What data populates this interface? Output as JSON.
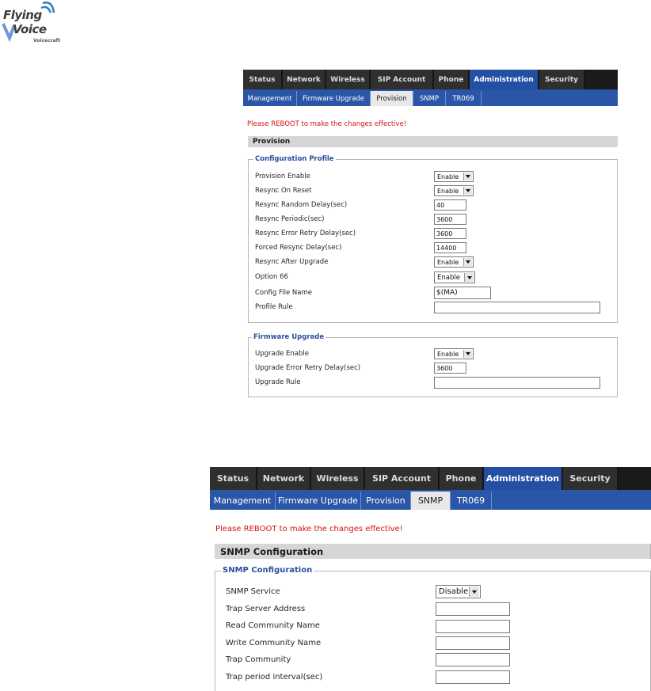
{
  "logo": {
    "line1": "Flying",
    "line2": "Voice",
    "line3": "Voicecraft"
  },
  "panel1": {
    "main_tabs": [
      {
        "label": "Status",
        "active": false
      },
      {
        "label": "Network",
        "active": false
      },
      {
        "label": "Wireless",
        "active": false
      },
      {
        "label": "SIP Account",
        "active": false
      },
      {
        "label": "Phone",
        "active": false
      },
      {
        "label": "Administration",
        "active": true
      },
      {
        "label": "Security",
        "active": false
      }
    ],
    "sub_tabs": [
      {
        "label": "Management",
        "active": false
      },
      {
        "label": "Firmware Upgrade",
        "active": false
      },
      {
        "label": "Provision",
        "active": true
      },
      {
        "label": "SNMP",
        "active": false
      },
      {
        "label": "TR069",
        "active": false
      }
    ],
    "warning": "Please REBOOT to make the changes effective!",
    "section_title": "Provision",
    "config_profile": {
      "legend": "Configuration Profile",
      "fields": [
        {
          "label": "Provision Enable",
          "type": "select",
          "value": "Enable"
        },
        {
          "label": "Resync On Reset",
          "type": "select",
          "value": "Enable"
        },
        {
          "label": "Resync Random Delay(sec)",
          "type": "input",
          "value": "40"
        },
        {
          "label": "Resync Periodic(sec)",
          "type": "input",
          "value": "3600"
        },
        {
          "label": "Resync Error Retry Delay(sec)",
          "type": "input",
          "value": "3600"
        },
        {
          "label": "Forced Resync Delay(sec)",
          "type": "input",
          "value": "14400"
        },
        {
          "label": "Resync After Upgrade",
          "type": "select",
          "value": "Enable"
        },
        {
          "label": "Option 66",
          "type": "select",
          "value": "Enable"
        },
        {
          "label": "Config File Name",
          "type": "input",
          "value": "$(MA)"
        },
        {
          "label": "Profile Rule",
          "type": "input",
          "value": ""
        }
      ]
    },
    "firmware_upgrade": {
      "legend": "Firmware Upgrade",
      "fields": [
        {
          "label": "Upgrade Enable",
          "type": "select",
          "value": "Enable"
        },
        {
          "label": "Upgrade Error Retry Delay(sec)",
          "type": "input",
          "value": "3600"
        },
        {
          "label": "Upgrade Rule",
          "type": "input",
          "value": ""
        }
      ]
    }
  },
  "panel2": {
    "main_tabs": [
      {
        "label": "Status",
        "active": false
      },
      {
        "label": "Network",
        "active": false
      },
      {
        "label": "Wireless",
        "active": false
      },
      {
        "label": "SIP Account",
        "active": false
      },
      {
        "label": "Phone",
        "active": false
      },
      {
        "label": "Administration",
        "active": true
      },
      {
        "label": "Security",
        "active": false
      }
    ],
    "sub_tabs": [
      {
        "label": "Management",
        "active": false
      },
      {
        "label": "Firmware Upgrade",
        "active": false
      },
      {
        "label": "Provision",
        "active": false
      },
      {
        "label": "SNMP",
        "active": true
      },
      {
        "label": "TR069",
        "active": false
      }
    ],
    "warning": "Please REBOOT to make the changes effective!",
    "section_title": "SNMP Configuration",
    "snmp": {
      "legend": "SNMP Configuration",
      "fields": [
        {
          "label": "SNMP Service",
          "type": "select",
          "value": "Disable"
        },
        {
          "label": "Trap Server Address",
          "type": "input",
          "value": ""
        },
        {
          "label": "Read Community Name",
          "type": "input",
          "value": ""
        },
        {
          "label": "Write Community Name",
          "type": "input",
          "value": ""
        },
        {
          "label": "Trap Community",
          "type": "input",
          "value": ""
        },
        {
          "label": "Trap period interval(sec)",
          "type": "input",
          "value": ""
        }
      ]
    }
  }
}
